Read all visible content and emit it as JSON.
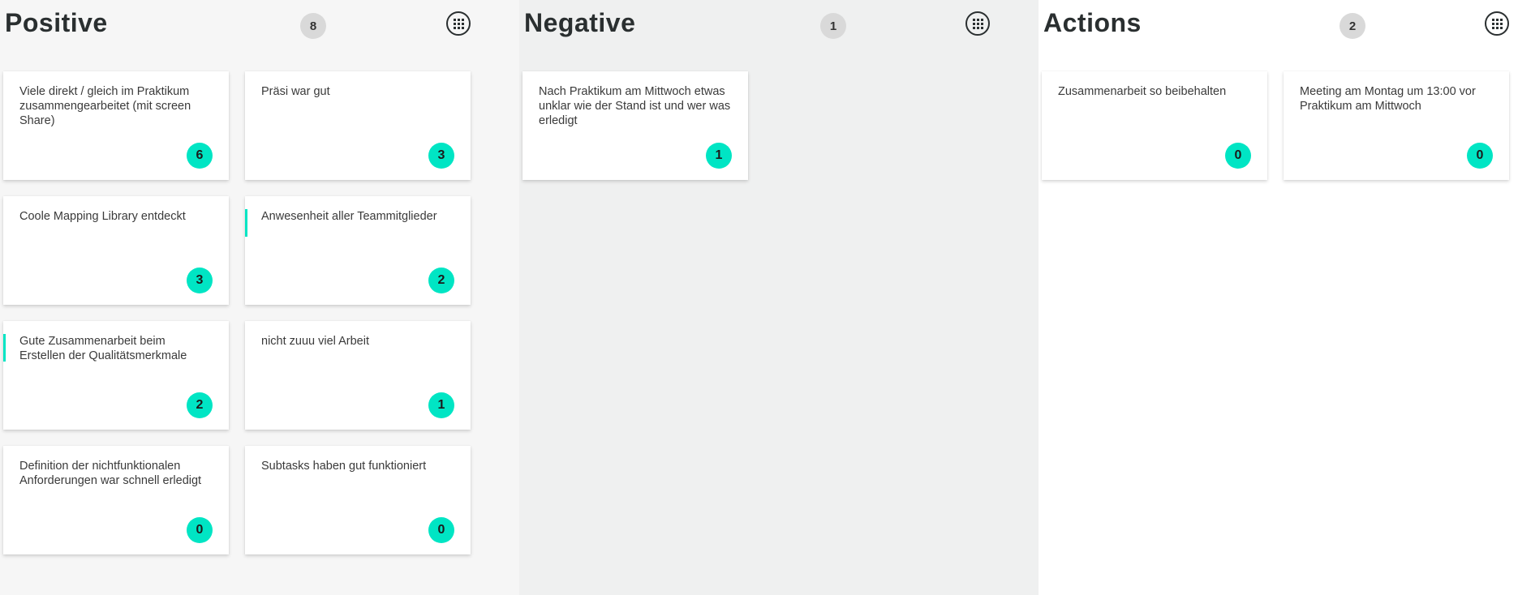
{
  "colors": {
    "positive_bg": "#f6f6f6",
    "negative_bg": "#eff0f0",
    "actions_bg": "#ffffff",
    "accent": "#00e5c4",
    "badge_gray": "#d9d9d9"
  },
  "columns": [
    {
      "title": "Positive",
      "count": "8",
      "menu_icon": "grid-menu-icon",
      "cards": [
        {
          "text": "Viele direkt / gleich im Praktikum zusammengearbeitet (mit screen Share)",
          "votes": "6"
        },
        {
          "text": "Präsi war gut",
          "votes": "3"
        },
        {
          "text": "Coole Mapping Library entdeckt",
          "votes": "3"
        },
        {
          "text": "Anwesenheit aller Teammitglieder",
          "votes": "2"
        },
        {
          "text": "Gute Zusammenarbeit beim Erstellen der Qualitätsmerkmale",
          "votes": "2"
        },
        {
          "text": "nicht zuuu viel Arbeit",
          "votes": "1"
        },
        {
          "text": "Definition der nichtfunktionalen Anforderungen war schnell erledigt",
          "votes": "0"
        },
        {
          "text": "Subtasks haben gut funktioniert",
          "votes": "0"
        }
      ]
    },
    {
      "title": "Negative",
      "count": "1",
      "menu_icon": "grid-menu-icon",
      "cards": [
        {
          "text": "Nach Praktikum am Mittwoch etwas unklar wie der Stand ist und wer was erledigt",
          "votes": "1"
        }
      ]
    },
    {
      "title": "Actions",
      "count": "2",
      "menu_icon": "grid-menu-icon",
      "cards": [
        {
          "text": "Zusammenarbeit so beibehalten",
          "votes": "0"
        },
        {
          "text": "Meeting am Montag um 13:00 vor Praktikum am Mittwoch",
          "votes": "0"
        }
      ]
    }
  ]
}
